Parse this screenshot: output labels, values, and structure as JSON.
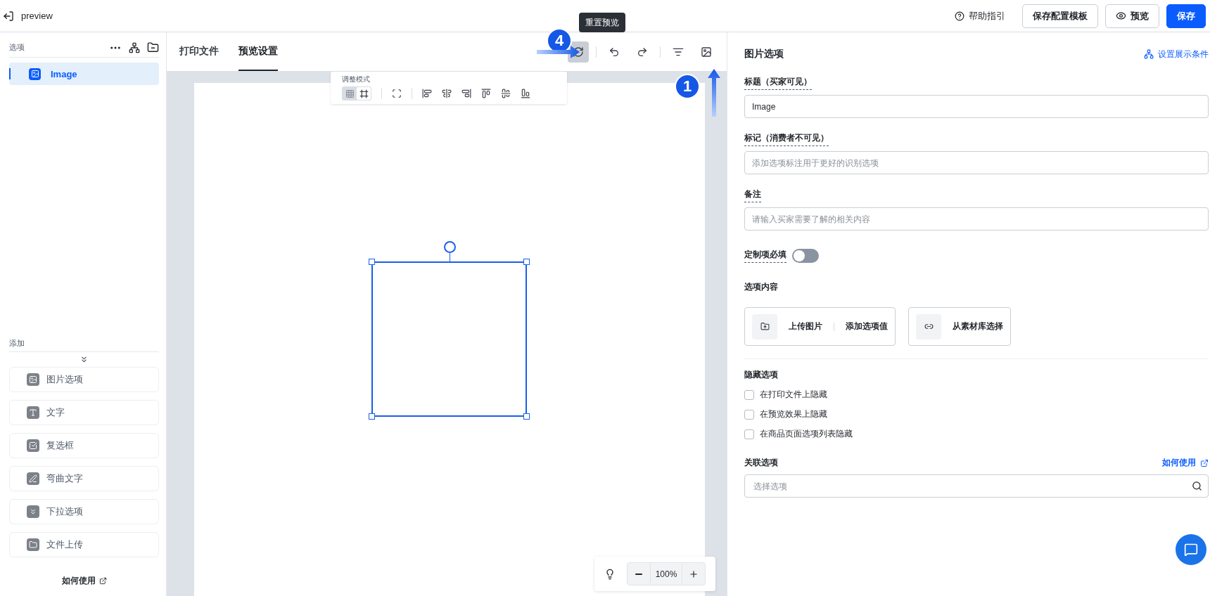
{
  "topbar": {
    "title": "preview",
    "help": "帮助指引",
    "buttons": [
      {
        "label": "保存配置模板",
        "kind": "outline"
      },
      {
        "label": "预览",
        "kind": "preview"
      },
      {
        "label": "保存",
        "kind": "primary"
      }
    ]
  },
  "sidebar": {
    "options_label": "选项",
    "items": [
      {
        "label": "Image",
        "selected": true
      }
    ],
    "add_label": "添加",
    "add_items": [
      {
        "label": "图片选项",
        "kind": "image"
      },
      {
        "label": "文字",
        "kind": "text"
      },
      {
        "label": "复选框",
        "kind": "checkbox"
      },
      {
        "label": "弯曲文字",
        "kind": "curve"
      },
      {
        "label": "下拉选项",
        "kind": "dropdown"
      },
      {
        "label": "文件上传",
        "kind": "file"
      }
    ],
    "help_link": "如何使用"
  },
  "center": {
    "tabs": [
      {
        "label": "打印文件",
        "selected": false
      },
      {
        "label": "预览设置",
        "selected": true
      }
    ],
    "tooltip": "重置预览",
    "adjust_label": "调整模式",
    "modes": [
      {
        "kind": "grid",
        "selected": false
      },
      {
        "kind": "frame",
        "selected": true
      }
    ],
    "badges": [
      {
        "label": "4"
      },
      {
        "label": "1"
      }
    ],
    "zoom": "100%"
  },
  "panel": {
    "title": "图片选项",
    "condition_link": "设置展示条件",
    "fields": [
      {
        "label": "标题（买家可见）",
        "value": "Image"
      },
      {
        "label": "标记（消费者不可见）",
        "placeholder": "添加选项标注用于更好的识别选项"
      },
      {
        "label": "备注",
        "placeholder": "请输入买家需要了解的相关内容"
      }
    ],
    "required": {
      "label": "定制项必填",
      "on": false
    },
    "content": {
      "label": "选项内容",
      "upload": "上传图片",
      "add_value": "添加选项值",
      "library": "从素材库选择"
    },
    "hide": {
      "label": "隐藏选项",
      "options": [
        {
          "label": "在打印文件上隐藏",
          "checked": false
        },
        {
          "label": "在预览效果上隐藏",
          "checked": false
        },
        {
          "label": "在商品页面选项列表隐藏",
          "checked": false
        }
      ]
    },
    "link": {
      "label": "关联选项",
      "help": "如何使用",
      "placeholder": "选择选项"
    }
  }
}
